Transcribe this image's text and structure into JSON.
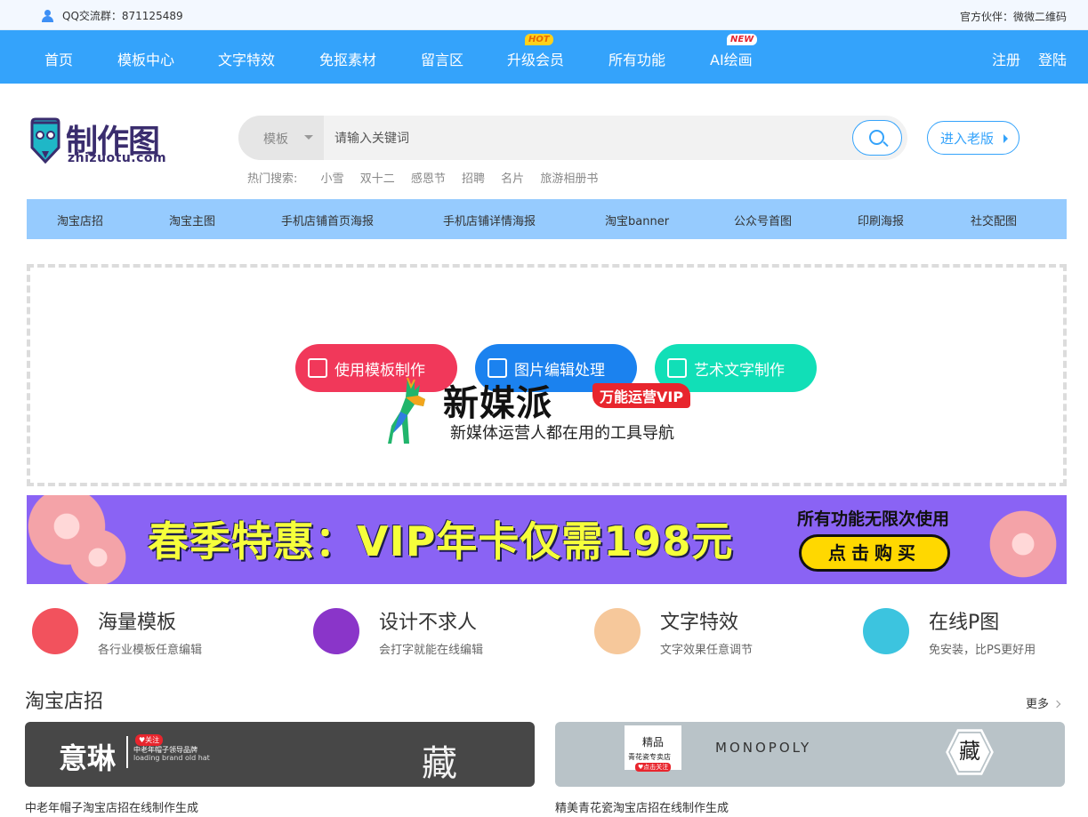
{
  "topbar": {
    "qq_group": "QQ交流群：871125489",
    "partner": "官方伙伴：微微二维码"
  },
  "nav": {
    "items": [
      "首页",
      "模板中心",
      "文字特效",
      "免抠素材",
      "留言区",
      "升级会员",
      "所有功能",
      "AI绘画"
    ],
    "badge_hot": "HOT",
    "badge_new": "NEW",
    "register": "注册",
    "login": "登陆"
  },
  "logo": {
    "name": "制作图",
    "domain": "zhizuotu.com"
  },
  "search": {
    "category": "模板",
    "placeholder": "请输入关键词",
    "old_version": "进入老版"
  },
  "hot_search": {
    "label": "热门搜索:",
    "terms": [
      "小雪",
      "双十二",
      "感恩节",
      "招聘",
      "名片",
      "旅游相册书"
    ]
  },
  "categories": [
    "淘宝店招",
    "淘宝主图",
    "手机店铺首页海报",
    "手机店铺详情海报",
    "淘宝banner",
    "公众号首图",
    "印刷海报",
    "社交配图"
  ],
  "hero": {
    "buttons": [
      "使用模板制作",
      "图片编辑处理",
      "艺术文字制作"
    ],
    "ad_title": "新媒派",
    "ad_badge": "万能运营VIP",
    "ad_sub": "新媒体运营人都在用的工具导航"
  },
  "promo": {
    "title": "春季特惠：VIP年卡仅需198元",
    "right_text": "所有功能无限次使用",
    "buy": "点击购买"
  },
  "features": [
    {
      "title": "海量模板",
      "desc": "各行业模板任意编辑",
      "icon": "layers-icon",
      "color": "#f2525d"
    },
    {
      "title": "设计不求人",
      "desc": "会打字就能在线编辑",
      "icon": "palette-icon",
      "color": "#8a35c9"
    },
    {
      "title": "文字特效",
      "desc": "文字效果任意调节",
      "icon": "number-one-icon",
      "color": "#f6c89b"
    },
    {
      "title": "在线P图",
      "desc": "免安装，比PS更好用",
      "icon": "pencil-icon",
      "color": "#3cc4df"
    }
  ],
  "section": {
    "title": "淘宝店招",
    "more": "更多"
  },
  "cards": [
    {
      "brand": "意琳",
      "tag": "♥关注",
      "line1": "中老年帽子领导品牌",
      "line2": "loading brand old hat",
      "mark": "藏",
      "caption": "中老年帽子淘宝店招在线制作生成"
    },
    {
      "box_title": "精品",
      "box_sub": "青花瓷专卖店",
      "box_tag": "♥点击关注",
      "brand": "MONOPOLY",
      "mark": "藏",
      "caption": "精美青花瓷淘宝店招在线制作生成"
    }
  ]
}
